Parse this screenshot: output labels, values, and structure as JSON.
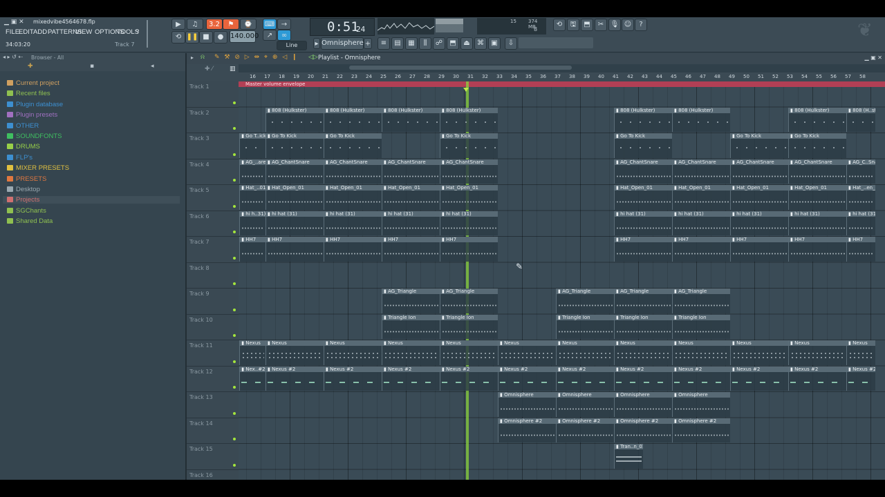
{
  "project": {
    "filename": "mixedvibe4564678.flp",
    "time_position": "34:03:20",
    "hint": "Track 7"
  },
  "menu": [
    "FILE",
    "EDIT",
    "ADD",
    "PATTERNS",
    "VIEW",
    "OPTIONS",
    "TOOLS",
    "?"
  ],
  "transport": {
    "tempo": "140.000",
    "time": "0:51",
    "time_sub": "24",
    "snap": "Line",
    "pattern": "Omnisphere",
    "cpu": "15",
    "ram": "374 MB",
    "polyphony": "8"
  },
  "browser": {
    "title": "Browser - All",
    "items": [
      {
        "label": "Current project",
        "color": "#d0a060"
      },
      {
        "label": "Recent files",
        "color": "#8fc050"
      },
      {
        "label": "Plugin database",
        "color": "#3d8fd0"
      },
      {
        "label": "Plugin presets",
        "color": "#a070c0"
      },
      {
        "label": "OTHER",
        "color": "#3d8fd0"
      },
      {
        "label": "SOUNDFONTS",
        "color": "#3fbf60"
      },
      {
        "label": "DRUMS",
        "color": "#98d048"
      },
      {
        "label": "FLP's",
        "color": "#3d8fd0"
      },
      {
        "label": "MIXER PRESETS",
        "color": "#e0c040"
      },
      {
        "label": "PRESETS",
        "color": "#e07840"
      },
      {
        "label": "Desktop",
        "color": "#9aa8b0"
      },
      {
        "label": "Projects",
        "color": "#d07070"
      },
      {
        "label": "SGChants",
        "color": "#8fc050"
      },
      {
        "label": "Shared Data",
        "color": "#8fc050"
      }
    ]
  },
  "playlist": {
    "title": "Playlist - Omnisphere",
    "envelope": "Master volume envelope",
    "ruler": [
      "16",
      "17",
      "18",
      "19",
      "20",
      "21",
      "22",
      "23",
      "24",
      "25",
      "26",
      "27",
      "28",
      "29",
      "30",
      "31",
      "32",
      "33",
      "34",
      "35",
      "36",
      "37",
      "38",
      "39",
      "40",
      "41",
      "42",
      "43",
      "44",
      "45",
      "46",
      "47",
      "48",
      "49",
      "50",
      "51",
      "52",
      "53",
      "54",
      "55",
      "56",
      "57",
      "58"
    ],
    "tracks": [
      "Track 1",
      "Track 2",
      "Track 3",
      "Track 4",
      "Track 5",
      "Track 6",
      "Track 7",
      "Track 8",
      "Track 9",
      "Track 10",
      "Track 11",
      "Track 12",
      "Track 13",
      "Track 14",
      "Track 15",
      "Track 16"
    ],
    "clips": [
      {
        "track": 2,
        "start": 0,
        "len": 1,
        "label": "808 (Hulkster)",
        "style": "sparse"
      },
      {
        "track": 2,
        "start": 1,
        "len": 1,
        "label": "808 (Hulkster)",
        "style": "sparse"
      },
      {
        "track": 2,
        "start": 2,
        "len": 1,
        "label": "808 (Hulkster)",
        "style": "sparse"
      },
      {
        "track": 2,
        "start": 3,
        "len": 1,
        "label": "808 (Hulkster)",
        "style": "sparse"
      },
      {
        "track": 2,
        "start": 6,
        "len": 1,
        "label": "808 (Hulkster)",
        "style": "sparse"
      },
      {
        "track": 2,
        "start": 7,
        "len": 1,
        "label": "808 (Hulkster)",
        "style": "sparse"
      },
      {
        "track": 2,
        "start": 9,
        "len": 1,
        "label": "808 (Hulkster)",
        "style": "sparse"
      },
      {
        "track": 2,
        "start": 10,
        "len": 0.5,
        "label": "808 (H..ster)",
        "style": "sparse"
      },
      {
        "track": 3,
        "start": -0.45,
        "len": 0.45,
        "label": "Go T..ick",
        "style": "sparse"
      },
      {
        "track": 3,
        "start": 0,
        "len": 1,
        "label": "Go To Kick",
        "style": "sparse"
      },
      {
        "track": 3,
        "start": 1,
        "len": 1,
        "label": "Go To Kick",
        "style": "sparse"
      },
      {
        "track": 3,
        "start": 3,
        "len": 1,
        "label": "Go To Kick",
        "style": "sparse"
      },
      {
        "track": 3,
        "start": 6,
        "len": 1,
        "label": "Go To Kick",
        "style": "sparse"
      },
      {
        "track": 3,
        "start": 8,
        "len": 1,
        "label": "Go To Kick",
        "style": "sparse"
      },
      {
        "track": 3,
        "start": 9,
        "len": 1,
        "label": "Go To Kick",
        "style": "sparse"
      },
      {
        "track": 4,
        "start": -0.45,
        "len": 0.45,
        "label": "AG_..are",
        "style": "dense"
      },
      {
        "track": 4,
        "start": 0,
        "len": 1,
        "label": "AG_ChantSnare",
        "style": "dense"
      },
      {
        "track": 4,
        "start": 1,
        "len": 1,
        "label": "AG_ChantSnare",
        "style": "dense"
      },
      {
        "track": 4,
        "start": 2,
        "len": 1,
        "label": "AG_ChantSnare",
        "style": "dense"
      },
      {
        "track": 4,
        "start": 3,
        "len": 1,
        "label": "AG_ChantSnare",
        "style": "dense"
      },
      {
        "track": 4,
        "start": 6,
        "len": 1,
        "label": "AG_ChantSnare",
        "style": "dense"
      },
      {
        "track": 4,
        "start": 7,
        "len": 1,
        "label": "AG_ChantSnare",
        "style": "dense"
      },
      {
        "track": 4,
        "start": 8,
        "len": 1,
        "label": "AG_ChantSnare",
        "style": "dense"
      },
      {
        "track": 4,
        "start": 9,
        "len": 1,
        "label": "AG_ChantSnare",
        "style": "dense"
      },
      {
        "track": 4,
        "start": 10,
        "len": 0.5,
        "label": "AG_C..Snare",
        "style": "dense"
      },
      {
        "track": 5,
        "start": -0.45,
        "len": 0.45,
        "label": "Hat_..01",
        "style": "dense"
      },
      {
        "track": 5,
        "start": 0,
        "len": 1,
        "label": "Hat_Open_01",
        "style": "dense"
      },
      {
        "track": 5,
        "start": 1,
        "len": 1,
        "label": "Hat_Open_01",
        "style": "dense"
      },
      {
        "track": 5,
        "start": 2,
        "len": 1,
        "label": "Hat_Open_01",
        "style": "dense"
      },
      {
        "track": 5,
        "start": 3,
        "len": 1,
        "label": "Hat_Open_01",
        "style": "dense"
      },
      {
        "track": 5,
        "start": 6,
        "len": 1,
        "label": "Hat_Open_01",
        "style": "dense"
      },
      {
        "track": 5,
        "start": 7,
        "len": 1,
        "label": "Hat_Open_01",
        "style": "dense"
      },
      {
        "track": 5,
        "start": 8,
        "len": 1,
        "label": "Hat_Open_01",
        "style": "dense"
      },
      {
        "track": 5,
        "start": 9,
        "len": 1,
        "label": "Hat_Open_01",
        "style": "dense"
      },
      {
        "track": 5,
        "start": 10,
        "len": 0.5,
        "label": "Hat_..en_01",
        "style": "dense"
      },
      {
        "track": 6,
        "start": -0.45,
        "len": 0.45,
        "label": "hi h..31)",
        "style": "dense"
      },
      {
        "track": 6,
        "start": 0,
        "len": 1,
        "label": "hi hat (31)",
        "style": "dense"
      },
      {
        "track": 6,
        "start": 1,
        "len": 1,
        "label": "hi hat (31)",
        "style": "dense"
      },
      {
        "track": 6,
        "start": 2,
        "len": 1,
        "label": "hi hat (31)",
        "style": "dense"
      },
      {
        "track": 6,
        "start": 3,
        "len": 1,
        "label": "hi hat (31)",
        "style": "dense"
      },
      {
        "track": 6,
        "start": 6,
        "len": 1,
        "label": "hi hat (31)",
        "style": "dense"
      },
      {
        "track": 6,
        "start": 7,
        "len": 1,
        "label": "hi hat (31)",
        "style": "dense"
      },
      {
        "track": 6,
        "start": 8,
        "len": 1,
        "label": "hi hat (31)",
        "style": "dense"
      },
      {
        "track": 6,
        "start": 9,
        "len": 1,
        "label": "hi hat (31)",
        "style": "dense"
      },
      {
        "track": 6,
        "start": 10,
        "len": 0.5,
        "label": "hi hat (31)",
        "style": "dense"
      },
      {
        "track": 7,
        "start": -0.45,
        "len": 0.45,
        "label": "HH7",
        "style": "dense"
      },
      {
        "track": 7,
        "start": 0,
        "len": 1,
        "label": "HH7",
        "style": "dense"
      },
      {
        "track": 7,
        "start": 1,
        "len": 1,
        "label": "HH7",
        "style": "dense"
      },
      {
        "track": 7,
        "start": 2,
        "len": 1,
        "label": "HH7",
        "style": "dense"
      },
      {
        "track": 7,
        "start": 3,
        "len": 1,
        "label": "HH7",
        "style": "dense"
      },
      {
        "track": 7,
        "start": 6,
        "len": 1,
        "label": "HH7",
        "style": "dense"
      },
      {
        "track": 7,
        "start": 7,
        "len": 1,
        "label": "HH7",
        "style": "dense"
      },
      {
        "track": 7,
        "start": 8,
        "len": 1,
        "label": "HH7",
        "style": "dense"
      },
      {
        "track": 7,
        "start": 9,
        "len": 1,
        "label": "HH7",
        "style": "dense"
      },
      {
        "track": 7,
        "start": 10,
        "len": 0.5,
        "label": "HH7",
        "style": "dense"
      },
      {
        "track": 9,
        "start": 2,
        "len": 1,
        "label": "AG_Triangle",
        "style": "dense"
      },
      {
        "track": 9,
        "start": 3,
        "len": 1,
        "label": "AG_Triangle",
        "style": "dense"
      },
      {
        "track": 9,
        "start": 5,
        "len": 1,
        "label": "AG_Triangle",
        "style": "dense"
      },
      {
        "track": 9,
        "start": 6,
        "len": 1,
        "label": "AG_Triangle",
        "style": "dense"
      },
      {
        "track": 9,
        "start": 7,
        "len": 1,
        "label": "AG_Triangle",
        "style": "dense"
      },
      {
        "track": 10,
        "start": 2,
        "len": 1,
        "label": "Triangle Ion",
        "style": "dense"
      },
      {
        "track": 10,
        "start": 3,
        "len": 1,
        "label": "Triangle Ion",
        "style": "dense"
      },
      {
        "track": 10,
        "start": 5,
        "len": 1,
        "label": "Triangle Ion",
        "style": "dense"
      },
      {
        "track": 10,
        "start": 6,
        "len": 1,
        "label": "Triangle Ion",
        "style": "dense"
      },
      {
        "track": 10,
        "start": 7,
        "len": 1,
        "label": "Triangle Ion",
        "style": "dense"
      },
      {
        "track": 11,
        "start": -0.45,
        "len": 0.45,
        "label": "Nexus",
        "style": ""
      },
      {
        "track": 11,
        "start": 0,
        "len": 1,
        "label": "Nexus",
        "style": ""
      },
      {
        "track": 11,
        "start": 1,
        "len": 1,
        "label": "Nexus",
        "style": ""
      },
      {
        "track": 11,
        "start": 2,
        "len": 1,
        "label": "Nexus",
        "style": ""
      },
      {
        "track": 11,
        "start": 3,
        "len": 1,
        "label": "Nexus",
        "style": ""
      },
      {
        "track": 11,
        "start": 4,
        "len": 1,
        "label": "Nexus",
        "style": ""
      },
      {
        "track": 11,
        "start": 5,
        "len": 1,
        "label": "Nexus",
        "style": ""
      },
      {
        "track": 11,
        "start": 6,
        "len": 1,
        "label": "Nexus",
        "style": ""
      },
      {
        "track": 11,
        "start": 7,
        "len": 1,
        "label": "Nexus",
        "style": ""
      },
      {
        "track": 11,
        "start": 8,
        "len": 1,
        "label": "Nexus",
        "style": ""
      },
      {
        "track": 11,
        "start": 9,
        "len": 1,
        "label": "Nexus",
        "style": ""
      },
      {
        "track": 11,
        "start": 10,
        "len": 0.5,
        "label": "Nexus",
        "style": ""
      },
      {
        "track": 12,
        "start": -0.45,
        "len": 0.45,
        "label": "Nex..#2",
        "style": "bars"
      },
      {
        "track": 12,
        "start": 0,
        "len": 1,
        "label": "Nexus #2",
        "style": "bars"
      },
      {
        "track": 12,
        "start": 1,
        "len": 1,
        "label": "Nexus #2",
        "style": "bars"
      },
      {
        "track": 12,
        "start": 2,
        "len": 1,
        "label": "Nexus #2",
        "style": "bars"
      },
      {
        "track": 12,
        "start": 3,
        "len": 1,
        "label": "Nexus #2",
        "style": "bars"
      },
      {
        "track": 12,
        "start": 4,
        "len": 1,
        "label": "Nexus #2",
        "style": "bars"
      },
      {
        "track": 12,
        "start": 5,
        "len": 1,
        "label": "Nexus #2",
        "style": "bars"
      },
      {
        "track": 12,
        "start": 6,
        "len": 1,
        "label": "Nexus #2",
        "style": "bars"
      },
      {
        "track": 12,
        "start": 7,
        "len": 1,
        "label": "Nexus #2",
        "style": "bars"
      },
      {
        "track": 12,
        "start": 8,
        "len": 1,
        "label": "Nexus #2",
        "style": "bars"
      },
      {
        "track": 12,
        "start": 9,
        "len": 1,
        "label": "Nexus #2",
        "style": "bars"
      },
      {
        "track": 12,
        "start": 10,
        "len": 0.5,
        "label": "Nexus #2",
        "style": "bars"
      },
      {
        "track": 13,
        "start": 4,
        "len": 1,
        "label": "Omnisphere",
        "style": "dense"
      },
      {
        "track": 13,
        "start": 5,
        "len": 1,
        "label": "Omnisphere",
        "style": "dense"
      },
      {
        "track": 13,
        "start": 6,
        "len": 1,
        "label": "Omnisphere",
        "style": "dense"
      },
      {
        "track": 13,
        "start": 7,
        "len": 1,
        "label": "Omnisphere",
        "style": "dense"
      },
      {
        "track": 14,
        "start": 4,
        "len": 1,
        "label": "Omnisphere #2",
        "style": "dense"
      },
      {
        "track": 14,
        "start": 5,
        "len": 1,
        "label": "Omnisphere #2",
        "style": "dense"
      },
      {
        "track": 14,
        "start": 6,
        "len": 1,
        "label": "Omnisphere #2",
        "style": "dense"
      },
      {
        "track": 14,
        "start": 7,
        "len": 1,
        "label": "Omnisphere #2",
        "style": "dense"
      },
      {
        "track": 15,
        "start": 6,
        "len": 0.5,
        "label": "Tran..n_01",
        "style": "wave"
      }
    ]
  }
}
